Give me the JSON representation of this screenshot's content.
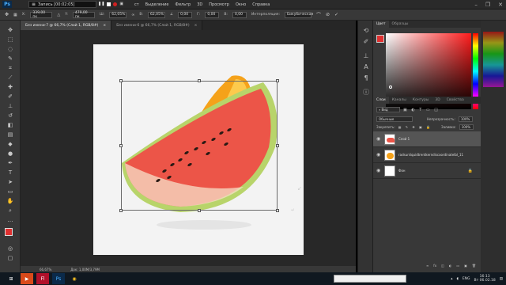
{
  "recorder": {
    "label": "Запись [00:02:05]"
  },
  "menu": [
    "ст",
    "Выделение",
    "Фильтр",
    "3D",
    "Просмотр",
    "Окно",
    "Справка"
  ],
  "options": {
    "x_value": "339,00 пк",
    "y_value": "479,00 пк",
    "w_value": "62,05%",
    "h_value": "62,05%",
    "angle_value": "0,00",
    "h_skew": "0,00",
    "v_skew": "0,00",
    "interp_label": "Интерполяция:",
    "interp_value": "Бикубическая"
  },
  "tabs": [
    {
      "label": "Без имени-7 @ 66,7% (Слой 1, RGB/8#)",
      "active": true
    },
    {
      "label": "Без имени-6 @ 66,7% (Слой 1, RGB/8#)",
      "active": false
    }
  ],
  "status": {
    "zoom": "66,67%",
    "doc": "Док: 1,00M/3,79M"
  },
  "color_panel": {
    "tabs": [
      "Цвет",
      "Образцы"
    ]
  },
  "layers_panel": {
    "tabs": [
      "Слои",
      "Каналы",
      "Контуры",
      "3D",
      "Свойства"
    ],
    "blend_mode": "Обычные",
    "opacity_label": "Непрозрачность:",
    "opacity_value": "100%",
    "fill_label": "Заливка:",
    "fill_value": "100%",
    "layers": [
      {
        "name": "Слой 1",
        "selected": true
      },
      {
        "name": "radsunliquidtrentkerndiscoordinatelbl_11",
        "selected": false
      },
      {
        "name": "Фон",
        "selected": false
      }
    ]
  },
  "taskbar": {
    "lang": "ENG",
    "time": "16:13",
    "date": "Вт 06.02.18"
  },
  "colors": {
    "foreground": "#e03030",
    "background": "#f4f4f4",
    "accent": "#1a73e8"
  }
}
